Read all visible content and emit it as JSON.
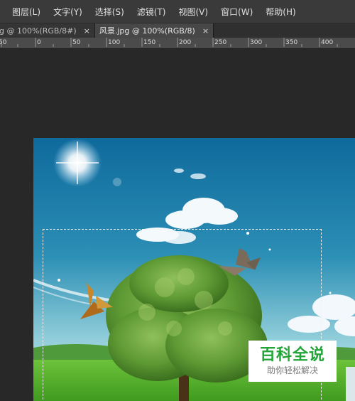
{
  "menu": {
    "items": [
      "图层(L)",
      "文字(Y)",
      "选择(S)",
      "滤镜(T)",
      "视图(V)",
      "窗口(W)",
      "帮助(H)"
    ]
  },
  "tabs": [
    {
      "label": "pg @ 100%(RGB/8#)",
      "close": "×",
      "active": false
    },
    {
      "label": "风景.jpg @ 100%(RGB/8)",
      "close": "×",
      "active": true
    }
  ],
  "ruler": {
    "labels": [
      "50",
      "0",
      "50",
      "100",
      "150",
      "200",
      "250",
      "300",
      "350",
      "400"
    ]
  },
  "watermark": {
    "title": "百科全说",
    "subtitle": "助你轻松解决"
  },
  "colors": {
    "menubar_bg": "#3a3a3a",
    "workspace_bg": "#282828",
    "ruler_bg": "#4b4b4b",
    "watermark_green": "#21a537"
  }
}
